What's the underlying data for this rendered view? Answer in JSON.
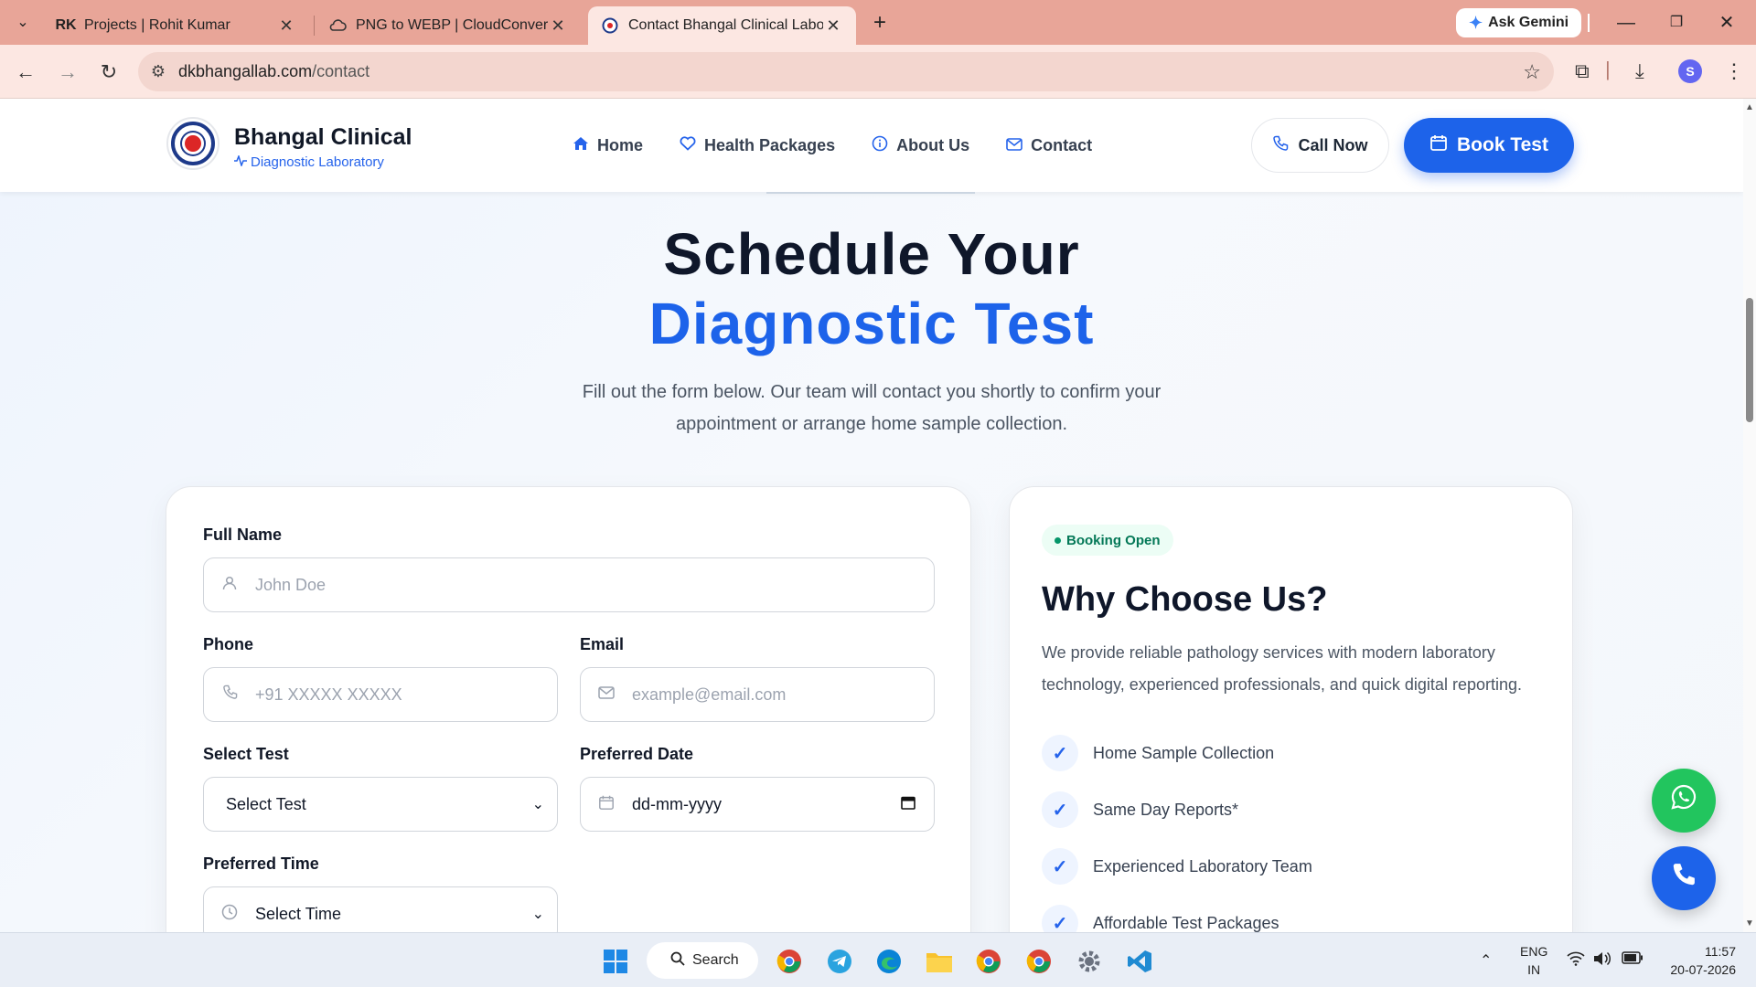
{
  "browser": {
    "tabs": [
      {
        "title": "Projects | Rohit Kumar",
        "icon": "rk-logo-icon",
        "favicon_text": "RK"
      },
      {
        "title": "PNG to WEBP | CloudConvert",
        "icon": "cloud-icon"
      },
      {
        "title": "Contact Bhangal Clinical Labora",
        "icon": "lab-logo-icon",
        "active": true
      }
    ],
    "gemini_label": "Ask Gemini",
    "url_domain": "dkbhangallab.com",
    "url_path": "/contact",
    "profile_initial": "S"
  },
  "site": {
    "brand_name": "Bhangal Clinical",
    "brand_sub": "Diagnostic Laboratory",
    "nav": [
      {
        "label": "Home",
        "icon": "home-icon"
      },
      {
        "label": "Health Packages",
        "icon": "heart-icon"
      },
      {
        "label": "About Us",
        "icon": "info-icon"
      },
      {
        "label": "Contact",
        "icon": "mail-icon"
      }
    ],
    "call_label": "Call Now",
    "book_label": "Book Test",
    "accent_color": "#1d63ea"
  },
  "hero": {
    "title_line1": "Schedule Your",
    "title_line2": "Diagnostic Test",
    "description": "Fill out the form below. Our team will contact you shortly to confirm your appointment or arrange home sample collection."
  },
  "form": {
    "full_name_label": "Full Name",
    "full_name_placeholder": "John Doe",
    "phone_label": "Phone",
    "phone_placeholder": "+91 XXXXX XXXXX",
    "email_label": "Email",
    "email_placeholder": "example@email.com",
    "test_label": "Select Test",
    "test_value": "Select Test",
    "date_label": "Preferred Date",
    "date_value": "dd-mm-yyyy",
    "time_label": "Preferred Time",
    "time_value": "Select Time"
  },
  "why": {
    "badge": "Booking Open",
    "title": "Why Choose Us?",
    "description": "We provide reliable pathology services with modern laboratory technology, experienced professionals, and quick digital reporting.",
    "features": [
      "Home Sample Collection",
      "Same Day Reports*",
      "Experienced Laboratory Team",
      "Affordable Test Packages"
    ]
  },
  "taskbar": {
    "search_label": "Search",
    "lang_line1": "ENG",
    "lang_line2": "IN",
    "time": "11:57",
    "date": "20-07-2026"
  }
}
